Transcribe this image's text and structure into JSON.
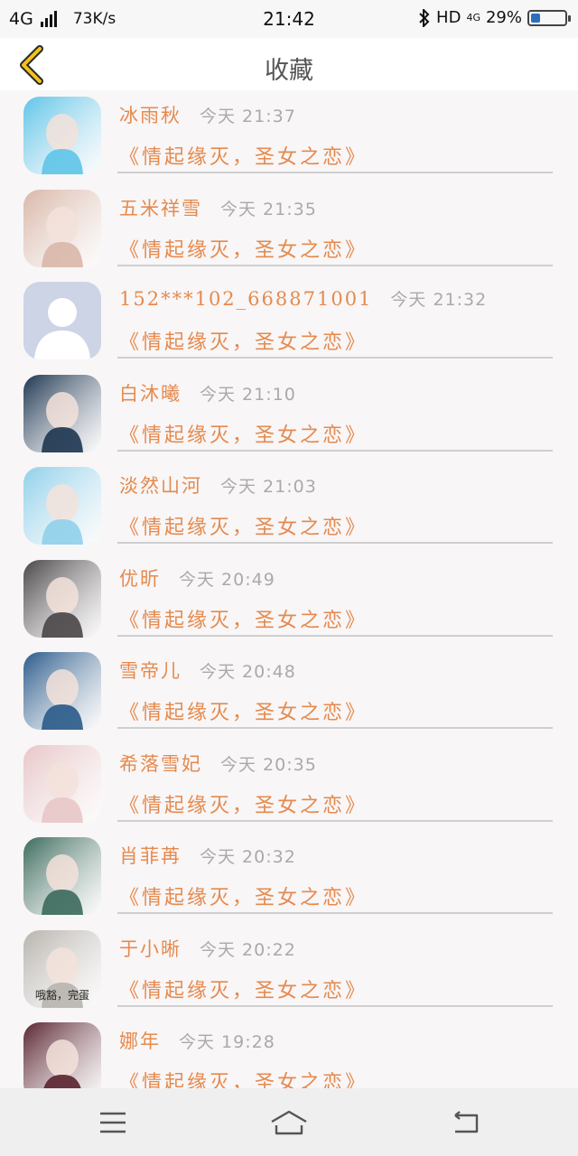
{
  "status_bar": {
    "network": "4G",
    "speed": "73K/s",
    "time": "21:42",
    "right_text": "HD",
    "network_small": "4G",
    "battery": "29%"
  },
  "header": {
    "title": "收藏",
    "back_icon": "chevron-left-icon",
    "accent": "#f0c419"
  },
  "favorites": [
    {
      "name": "冰雨秋",
      "time": "今天 21:37",
      "title": "《情起缘灭，圣女之恋》"
    },
    {
      "name": "五米祥雪",
      "time": "今天 21:35",
      "title": "《情起缘灭，圣女之恋》"
    },
    {
      "name": "152***102_668871001",
      "time": "今天 21:32",
      "title": "《情起缘灭，圣女之恋》"
    },
    {
      "name": "白沐曦",
      "time": "今天 21:10",
      "title": "《情起缘灭，圣女之恋》"
    },
    {
      "name": "淡然山河",
      "time": "今天 21:03",
      "title": "《情起缘灭，圣女之恋》"
    },
    {
      "name": "优昕",
      "time": "今天 20:49",
      "title": "《情起缘灭，圣女之恋》"
    },
    {
      "name": "雪帝儿",
      "time": "今天 20:48",
      "title": "《情起缘灭，圣女之恋》"
    },
    {
      "name": "希落雪妃",
      "time": "今天 20:35",
      "title": "《情起缘灭，圣女之恋》"
    },
    {
      "name": "肖菲苒",
      "time": "今天 20:32",
      "title": "《情起缘灭，圣女之恋》"
    },
    {
      "name": "于小晰",
      "time": "今天 20:22",
      "title": "《情起缘灭，圣女之恋》",
      "avatar_caption": "哦豁，完蛋"
    },
    {
      "name": "娜年",
      "time": "今天 19:28",
      "title": "《情起缘灭，圣女之恋》"
    }
  ],
  "avatar_colors": [
    "#5fc4e8",
    "#d9b7a8",
    "#cdd4e6",
    "#1d3550",
    "#8fd0ea",
    "#4a4648",
    "#2a5a8a",
    "#e8c6c8",
    "#3b6a5c",
    "#b8b4ae",
    "#5a2430"
  ],
  "colors": {
    "accent": "#e58a4e",
    "secondary_text": "#aaaaaa"
  },
  "nav": {
    "menu_icon": "menu-icon",
    "home_icon": "home-icon",
    "back_icon": "back-arrow-icon"
  }
}
